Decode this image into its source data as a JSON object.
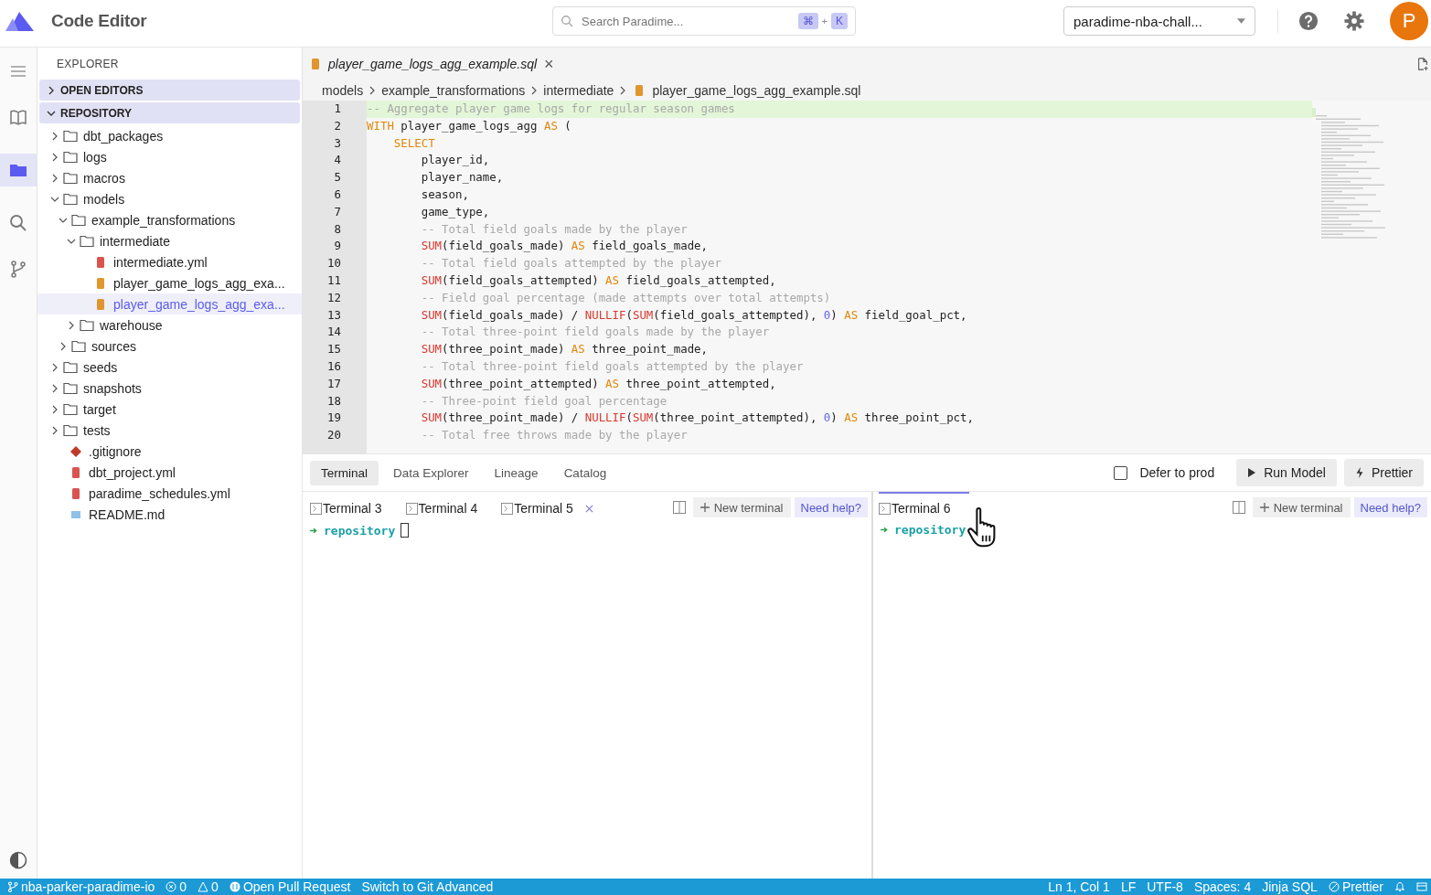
{
  "app": {
    "title": "Code Editor",
    "search": {
      "placeholder": "Search Paradime...",
      "keys": [
        "⌘",
        "+",
        "K"
      ]
    },
    "workspace": "paradime-nba-chall...",
    "avatar": "P"
  },
  "explorer": {
    "title": "EXPLORER",
    "sections": [
      {
        "label": "OPEN EDITORS",
        "expanded": false
      },
      {
        "label": "REPOSITORY",
        "expanded": true
      }
    ],
    "tree": [
      {
        "label": "dbt_packages",
        "kind": "folder",
        "expanded": false,
        "selected": false
      },
      {
        "label": "logs",
        "kind": "folder",
        "expanded": false,
        "selected": false
      },
      {
        "label": "macros",
        "kind": "folder",
        "expanded": false,
        "selected": false
      },
      {
        "label": "models",
        "kind": "folder",
        "expanded": true,
        "selected": false,
        "children": [
          {
            "label": "example_transformations",
            "kind": "folder",
            "expanded": true,
            "selected": false,
            "children": [
              {
                "label": "intermediate",
                "kind": "folder",
                "expanded": true,
                "selected": false,
                "children": [
                  {
                    "label": "intermediate.yml",
                    "kind": "yml",
                    "selected": false
                  },
                  {
                    "label": "player_game_logs_agg_exa...",
                    "kind": "sql",
                    "selected": false
                  },
                  {
                    "label": "player_game_logs_agg_exa...",
                    "kind": "sql",
                    "selected": true
                  }
                ]
              },
              {
                "label": "warehouse",
                "kind": "folder",
                "expanded": false,
                "selected": false
              }
            ]
          },
          {
            "label": "sources",
            "kind": "folder",
            "expanded": false,
            "selected": false
          }
        ]
      },
      {
        "label": "seeds",
        "kind": "folder",
        "expanded": false,
        "selected": false
      },
      {
        "label": "snapshots",
        "kind": "folder",
        "expanded": false,
        "selected": false
      },
      {
        "label": "target",
        "kind": "folder",
        "expanded": false,
        "selected": false
      },
      {
        "label": "tests",
        "kind": "folder",
        "expanded": false,
        "selected": false
      },
      {
        "label": ".gitignore",
        "kind": "git",
        "selected": false
      },
      {
        "label": "dbt_project.yml",
        "kind": "yml",
        "selected": false
      },
      {
        "label": "paradime_schedules.yml",
        "kind": "yml",
        "selected": false
      },
      {
        "label": "README.md",
        "kind": "md",
        "selected": false
      }
    ]
  },
  "editor": {
    "tab": {
      "label": "player_game_logs_agg_example.sql",
      "close": "×"
    },
    "breadcrumbs": [
      "models",
      "example_transformations",
      "intermediate",
      "player_game_logs_agg_example.sql"
    ],
    "lines": [
      {
        "number": "1",
        "highlighted": true,
        "tokens": [
          {
            "kind": "comment",
            "text": "-- Aggregate player game logs for regular season games"
          }
        ]
      },
      {
        "number": "2",
        "highlighted": false,
        "tokens": [
          {
            "kind": "keyword",
            "text": "WITH"
          },
          {
            "kind": "plain",
            "text": " player_game_logs_agg "
          },
          {
            "kind": "keyword",
            "text": "AS"
          },
          {
            "kind": "plain",
            "text": " ("
          }
        ]
      },
      {
        "number": "3",
        "highlighted": false,
        "tokens": [
          {
            "kind": "keyword",
            "text": "    SELECT"
          }
        ]
      },
      {
        "number": "4",
        "highlighted": false,
        "tokens": [
          {
            "kind": "plain",
            "text": "        player_id,"
          }
        ]
      },
      {
        "number": "5",
        "highlighted": false,
        "tokens": [
          {
            "kind": "plain",
            "text": "        player_name,"
          }
        ]
      },
      {
        "number": "6",
        "highlighted": false,
        "tokens": [
          {
            "kind": "plain",
            "text": "        season,"
          }
        ]
      },
      {
        "number": "7",
        "highlighted": false,
        "tokens": [
          {
            "kind": "plain",
            "text": "        game_type,"
          }
        ]
      },
      {
        "number": "8",
        "highlighted": false,
        "tokens": [
          {
            "kind": "comment",
            "text": "        -- Total field goals made by the player"
          }
        ]
      },
      {
        "number": "9",
        "highlighted": false,
        "tokens": [
          {
            "kind": "function",
            "text": "        SUM"
          },
          {
            "kind": "plain",
            "text": "(field_goals_made) "
          },
          {
            "kind": "keyword",
            "text": "AS"
          },
          {
            "kind": "plain",
            "text": " field_goals_made,"
          }
        ]
      },
      {
        "number": "10",
        "highlighted": false,
        "tokens": [
          {
            "kind": "comment",
            "text": "        -- Total field goals attempted by the player"
          }
        ]
      },
      {
        "number": "11",
        "highlighted": false,
        "tokens": [
          {
            "kind": "function",
            "text": "        SUM"
          },
          {
            "kind": "plain",
            "text": "(field_goals_attempted) "
          },
          {
            "kind": "keyword",
            "text": "AS"
          },
          {
            "kind": "plain",
            "text": " field_goals_attempted,"
          }
        ]
      },
      {
        "number": "12",
        "highlighted": false,
        "tokens": [
          {
            "kind": "comment",
            "text": "        -- Field goal percentage (made attempts over total attempts)"
          }
        ]
      },
      {
        "number": "13",
        "highlighted": false,
        "tokens": [
          {
            "kind": "function",
            "text": "        SUM"
          },
          {
            "kind": "plain",
            "text": "(field_goals_made) / "
          },
          {
            "kind": "function",
            "text": "NULLIF"
          },
          {
            "kind": "plain",
            "text": "("
          },
          {
            "kind": "function",
            "text": "SUM"
          },
          {
            "kind": "plain",
            "text": "(field_goals_attempted), "
          },
          {
            "kind": "number",
            "text": "0"
          },
          {
            "kind": "plain",
            "text": ") "
          },
          {
            "kind": "keyword",
            "text": "AS"
          },
          {
            "kind": "plain",
            "text": " field_goal_pct,"
          }
        ]
      },
      {
        "number": "14",
        "highlighted": false,
        "tokens": [
          {
            "kind": "comment",
            "text": "        -- Total three-point field goals made by the player"
          }
        ]
      },
      {
        "number": "15",
        "highlighted": false,
        "tokens": [
          {
            "kind": "function",
            "text": "        SUM"
          },
          {
            "kind": "plain",
            "text": "(three_point_made) "
          },
          {
            "kind": "keyword",
            "text": "AS"
          },
          {
            "kind": "plain",
            "text": " three_point_made,"
          }
        ]
      },
      {
        "number": "16",
        "highlighted": false,
        "tokens": [
          {
            "kind": "comment",
            "text": "        -- Total three-point field goals attempted by the player"
          }
        ]
      },
      {
        "number": "17",
        "highlighted": false,
        "tokens": [
          {
            "kind": "function",
            "text": "        SUM"
          },
          {
            "kind": "plain",
            "text": "(three_point_attempted) "
          },
          {
            "kind": "keyword",
            "text": "AS"
          },
          {
            "kind": "plain",
            "text": " three_point_attempted,"
          }
        ]
      },
      {
        "number": "18",
        "highlighted": false,
        "tokens": [
          {
            "kind": "comment",
            "text": "        -- Three-point field goal percentage"
          }
        ]
      },
      {
        "number": "19",
        "highlighted": false,
        "tokens": [
          {
            "kind": "function",
            "text": "        SUM"
          },
          {
            "kind": "plain",
            "text": "(three_point_made) / "
          },
          {
            "kind": "function",
            "text": "NULLIF"
          },
          {
            "kind": "plain",
            "text": "("
          },
          {
            "kind": "function",
            "text": "SUM"
          },
          {
            "kind": "plain",
            "text": "(three_point_attempted), "
          },
          {
            "kind": "number",
            "text": "0"
          },
          {
            "kind": "plain",
            "text": ") "
          },
          {
            "kind": "keyword",
            "text": "AS"
          },
          {
            "kind": "plain",
            "text": " three_point_pct,"
          }
        ]
      },
      {
        "number": "20",
        "highlighted": false,
        "tokens": [
          {
            "kind": "comment",
            "text": "        -- Total free throws made by the player"
          }
        ]
      }
    ]
  },
  "panel": {
    "tabs": [
      {
        "label": "Terminal",
        "selected": true
      },
      {
        "label": "Data Explorer",
        "selected": false
      },
      {
        "label": "Lineage",
        "selected": false
      },
      {
        "label": "Catalog",
        "selected": false
      }
    ],
    "defer_to_prod": {
      "label": "Defer to prod",
      "checked": false
    },
    "buttons": [
      {
        "label": "Run Model",
        "kind": "run"
      },
      {
        "label": "Prettier",
        "kind": "bolt"
      }
    ],
    "panes": [
      {
        "terminals": [
          {
            "label": "Terminal 3",
            "selected": false,
            "closable": false
          },
          {
            "label": "Terminal 4",
            "selected": false,
            "closable": false
          },
          {
            "label": "Terminal 5",
            "selected": false,
            "closable": true
          }
        ],
        "new_terminal": "New terminal",
        "help": "Need help?",
        "prompt": "repository",
        "cursor": true
      },
      {
        "terminals": [
          {
            "label": "Terminal 6",
            "selected": true,
            "closable": false
          }
        ],
        "new_terminal": "New terminal",
        "help": "Need help?",
        "prompt": "repository",
        "cursor": false
      }
    ]
  },
  "status_bar": {
    "left": [
      {
        "kind": "branch",
        "text": "nba-parker-paradime-io"
      },
      {
        "kind": "problems",
        "text": "0"
      },
      {
        "kind": "warnings",
        "text": "0"
      },
      {
        "kind": "pr",
        "text": "Open Pull Request"
      },
      {
        "kind": "plain",
        "text": "Switch to Git Advanced"
      }
    ],
    "right": [
      "Ln 1, Col 1",
      "LF",
      "UTF-8",
      "Spaces: 4",
      "Jinja SQL"
    ],
    "prettier": "Prettier"
  }
}
